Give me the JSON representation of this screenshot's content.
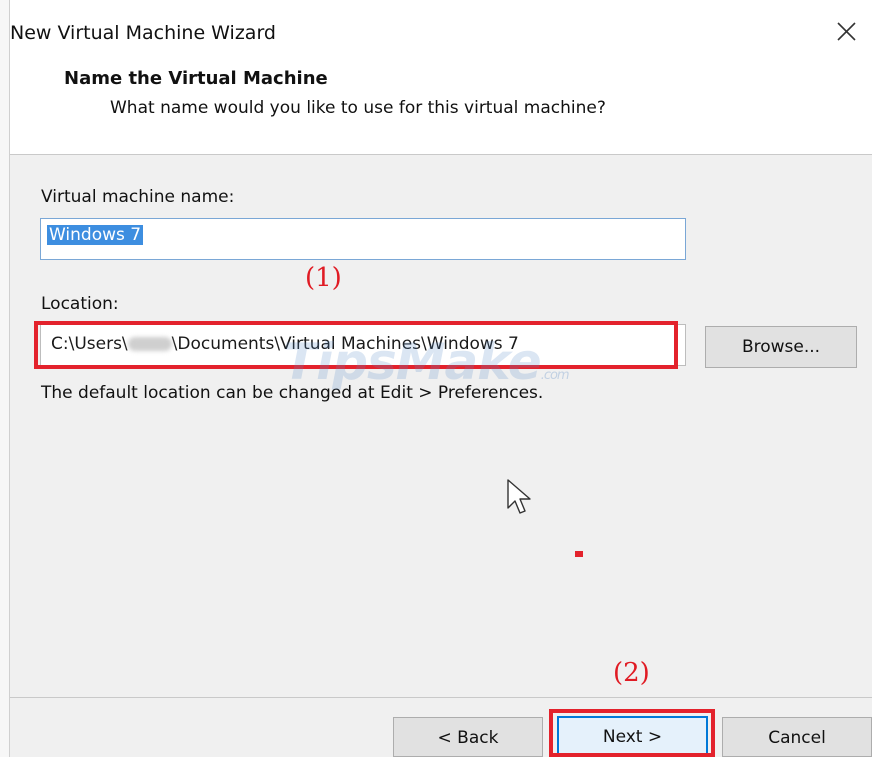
{
  "window": {
    "title": "New Virtual Machine Wizard",
    "close_icon": "close-icon"
  },
  "header": {
    "title": "Name the Virtual Machine",
    "subtitle": "What name would you like to use for this virtual machine?"
  },
  "form": {
    "vm_name_label": "Virtual machine name:",
    "vm_name_value": "Windows 7",
    "location_label": "Location:",
    "location_prefix": "C:\\Users\\",
    "location_suffix": "\\Documents\\Virtual Machines\\Windows 7",
    "browse_label": "Browse...",
    "hint": "The default location can be changed at Edit > Preferences."
  },
  "annotations": {
    "marker_1": "(1)",
    "marker_2": "(2)",
    "color": "#e3222c"
  },
  "watermark": {
    "text": "TipsMake",
    "suffix": ".com"
  },
  "footer": {
    "back_label": "< Back",
    "next_label": "Next >",
    "cancel_label": "Cancel"
  },
  "colors": {
    "selection": "#3d8ee0",
    "field_border": "#7aa7d6",
    "annotation": "#e3222c"
  }
}
